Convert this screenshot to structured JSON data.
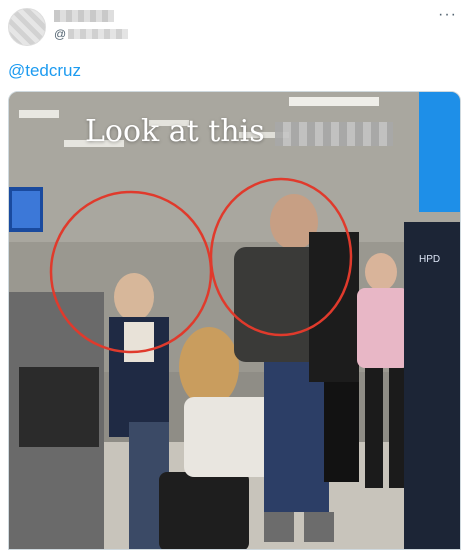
{
  "tweet": {
    "handle_prefix": "@",
    "more_icon": "more-horizontal-icon",
    "text": "@tedcruz"
  },
  "media": {
    "caption": "Look at this",
    "airport_sign": "HPD",
    "accent_color": "#1d9bf0",
    "circle_color": "#e03a2c"
  }
}
